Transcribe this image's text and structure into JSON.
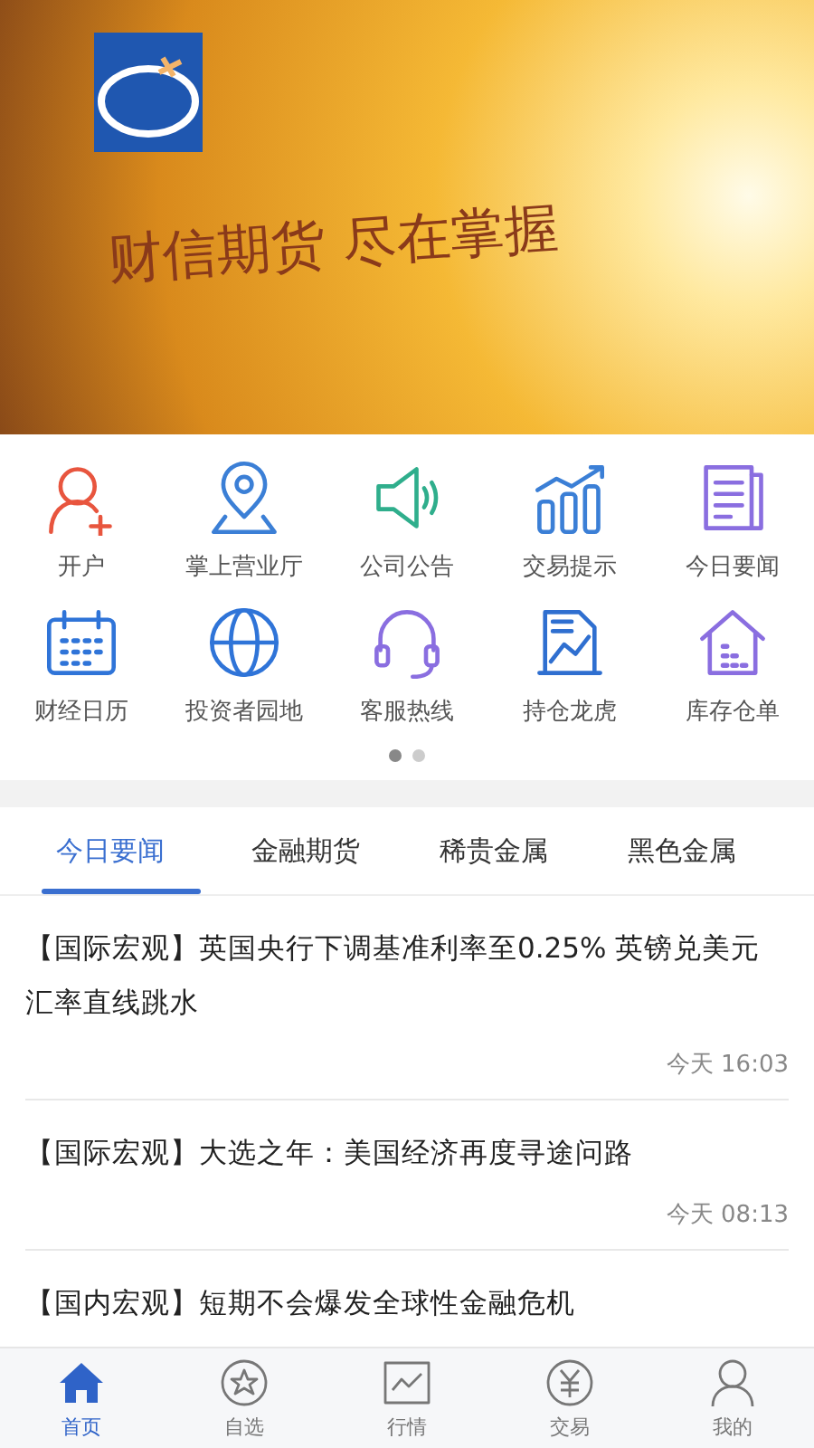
{
  "banner": {
    "slogan": "财信期货 尽在掌握"
  },
  "shortcuts": [
    {
      "label": "开户",
      "color": "#e8553e"
    },
    {
      "label": "掌上营业厅",
      "color": "#3b7fd6"
    },
    {
      "label": "公司公告",
      "color": "#2fae8c"
    },
    {
      "label": "交易提示",
      "color": "#3b7fd6"
    },
    {
      "label": "今日要闻",
      "color": "#8a6ee0"
    },
    {
      "label": "财经日历",
      "color": "#2f74d8"
    },
    {
      "label": "投资者园地",
      "color": "#2f74d8"
    },
    {
      "label": "客服热线",
      "color": "#8a6ee0"
    },
    {
      "label": "持仓龙虎",
      "color": "#2f6fd0"
    },
    {
      "label": "库存仓单",
      "color": "#8a6ee0"
    }
  ],
  "pager": [
    {
      "selected": true
    },
    {
      "selected": false
    }
  ],
  "tabs": [
    {
      "label": "今日要闻",
      "selected": true
    },
    {
      "label": "金融期货",
      "selected": false
    },
    {
      "label": "稀贵金属",
      "selected": false
    },
    {
      "label": "黑色金属",
      "selected": false
    }
  ],
  "news": [
    {
      "title": "【国际宏观】英国央行下调基准利率至0.25% 英镑兑美元汇率直线跳水",
      "time": "今天 16:03"
    },
    {
      "title": "【国际宏观】大选之年：美国经济再度寻途问路",
      "time": "今天 08:13"
    },
    {
      "title": "【国内宏观】短期不会爆发全球性金融危机"
    }
  ],
  "nav": [
    {
      "label": "首页",
      "selected": true
    },
    {
      "label": "自选",
      "selected": false
    },
    {
      "label": "行情",
      "selected": false
    },
    {
      "label": "交易",
      "selected": false
    },
    {
      "label": "我的",
      "selected": false
    }
  ]
}
